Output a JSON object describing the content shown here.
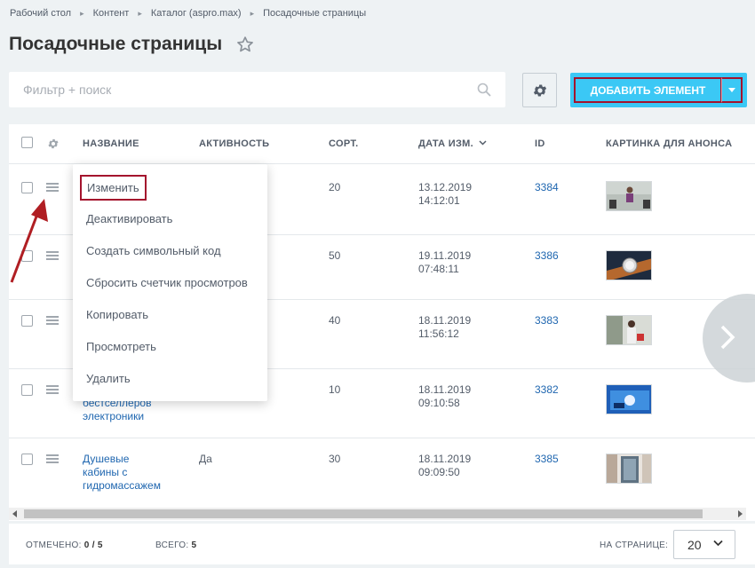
{
  "breadcrumb": [
    "Рабочий стол",
    "Контент",
    "Каталог (aspro.max)",
    "Посадочные страницы"
  ],
  "page_title": "Посадочные страницы",
  "filter": {
    "placeholder": "Фильтр + поиск"
  },
  "toolbar": {
    "add_label": "ДОБАВИТЬ ЭЛЕМЕНТ"
  },
  "columns": {
    "name": "НАЗВАНИЕ",
    "active": "АКТИВНОСТЬ",
    "sort": "СОРТ.",
    "date": "ДАТА ИЗМ.",
    "id": "ID",
    "image": "КАРТИНКА ДЛЯ АНОНСА"
  },
  "rows": [
    {
      "name_lines": [],
      "active": "",
      "sort": "20",
      "date": "13.12.2019",
      "time": "14:12:01",
      "id": "3384"
    },
    {
      "name_lines": [],
      "active": "",
      "sort": "50",
      "date": "19.11.2019",
      "time": "07:48:11",
      "id": "3386"
    },
    {
      "name_lines": [],
      "active": "",
      "sort": "40",
      "date": "18.11.2019",
      "time": "11:56:12",
      "id": "3383"
    },
    {
      "name_lines": [
        "бестселлеров",
        "электроники"
      ],
      "active": "",
      "sort": "10",
      "date": "18.11.2019",
      "time": "09:10:58",
      "id": "3382"
    },
    {
      "name_lines": [
        "Душевые",
        "кабины с",
        "гидромассажем"
      ],
      "active": "Да",
      "sort": "30",
      "date": "18.11.2019",
      "time": "09:09:50",
      "id": "3385"
    }
  ],
  "context_menu": [
    "Изменить",
    "Деактивировать",
    "Создать символьный код",
    "Сбросить счетчик просмотров",
    "Копировать",
    "Просмотреть",
    "Удалить"
  ],
  "footer": {
    "checked_label": "ОТМЕЧЕНО:",
    "checked_value": "0 / 5",
    "total_label": "ВСЕГО:",
    "total_value": "5",
    "per_page_label": "НА СТРАНИЦЕ:",
    "per_page_value": "20"
  },
  "colors": {
    "accent": "#3bc8f5",
    "highlight_border": "#a4132d",
    "link": "#2067b0"
  }
}
